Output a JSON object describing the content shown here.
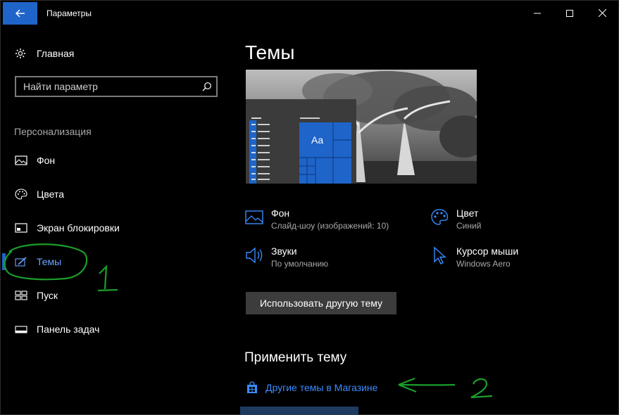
{
  "window": {
    "title": "Параметры"
  },
  "sidebar": {
    "home_label": "Главная",
    "search_placeholder": "Найти параметр",
    "section_label": "Персонализация",
    "items": [
      {
        "label": "Фон",
        "icon": "image-icon"
      },
      {
        "label": "Цвета",
        "icon": "palette-icon"
      },
      {
        "label": "Экран блокировки",
        "icon": "lock-screen-icon"
      },
      {
        "label": "Темы",
        "icon": "themes-icon",
        "active": true
      },
      {
        "label": "Пуск",
        "icon": "start-icon"
      },
      {
        "label": "Панель задач",
        "icon": "taskbar-icon"
      }
    ]
  },
  "main": {
    "title": "Темы",
    "preview_tile_text": "Aa",
    "props": {
      "background": {
        "title": "Фон",
        "value": "Слайд-шоу (изображений: 10)"
      },
      "color": {
        "title": "Цвет",
        "value": "Синий"
      },
      "sounds": {
        "title": "Звуки",
        "value": "По умолчанию"
      },
      "cursor": {
        "title": "Курсор мыши",
        "value": "Windows Aero"
      }
    },
    "use_other_theme_label": "Использовать другую тему",
    "apply_theme_title": "Применить тему",
    "store_link_label": "Другие темы в Магазине"
  },
  "annotations": {
    "mark_1": "1",
    "mark_2": "2"
  },
  "colors": {
    "accent": "#1f64c8",
    "link": "#3a8bff",
    "annotation": "#1a9e2a",
    "background": "#000000"
  }
}
